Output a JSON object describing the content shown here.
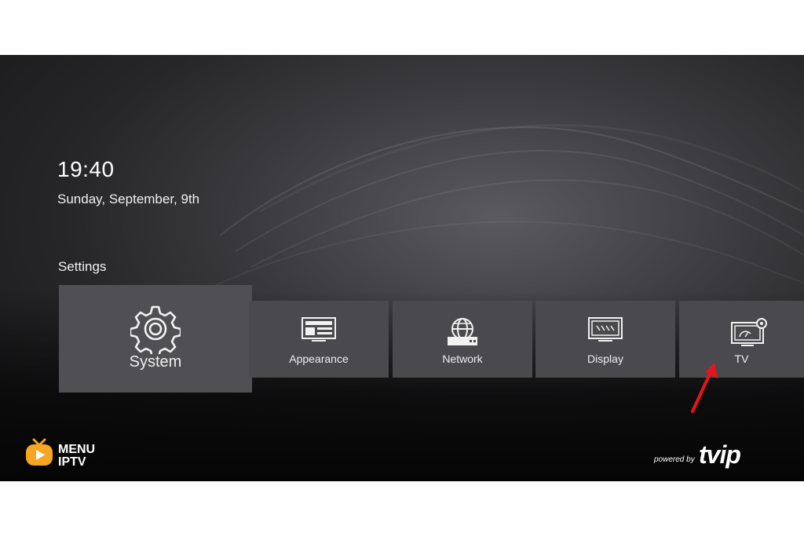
{
  "clock": {
    "time": "19:40",
    "date": "Sunday, September,  9th"
  },
  "section": {
    "title": "Settings"
  },
  "tiles": [
    {
      "label": "System",
      "icon": "gear-icon"
    },
    {
      "label": "Appearance",
      "icon": "appearance-screen-icon"
    },
    {
      "label": "Network",
      "icon": "network-globe-icon"
    },
    {
      "label": "Display",
      "icon": "display-monitor-icon"
    },
    {
      "label": "TV",
      "icon": "tv-settings-icon"
    }
  ],
  "brand": {
    "line1": "MENU",
    "line2": "IPTV",
    "accent": "#f5a623"
  },
  "footer": {
    "powered": "powered by",
    "logo": "tvip"
  },
  "annotation": {
    "arrow_color": "#e8141b"
  }
}
